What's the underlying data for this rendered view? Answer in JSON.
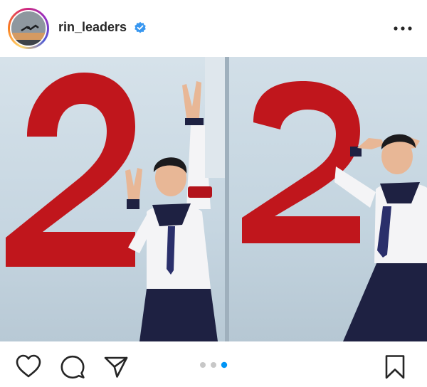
{
  "post": {
    "username": "rin_leaders",
    "verified": true,
    "carousel": {
      "total": 3,
      "active_index": 3
    }
  },
  "icons": {
    "header": [
      "verified-badge-icon",
      "more-options-icon"
    ],
    "actions": [
      "heart-icon",
      "comment-icon",
      "share-icon",
      "bookmark-icon"
    ]
  },
  "colors": {
    "verified": "#3897f0",
    "carousel_active": "#0095f6",
    "carousel_inactive": "#c7c7c7",
    "numeral_red": "#c0161c"
  }
}
